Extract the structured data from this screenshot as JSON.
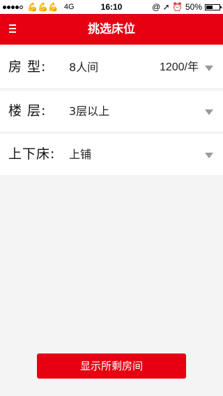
{
  "status_bar": {
    "signal_icons": "●●●○○",
    "emoji": "💪💪💪",
    "network": "4G",
    "time": "16:10",
    "right_icons": "@ ➚ ⏰",
    "battery": "50%",
    "battery_level": 0.5
  },
  "navbar": {
    "title": "挑选床位",
    "menu_icon": "hamburger-icon"
  },
  "rows": [
    {
      "label": "房  型:",
      "value": "8人间",
      "extra": "1200/年"
    },
    {
      "label": "楼  层:",
      "value": "3层以上",
      "extra": ""
    },
    {
      "label": "上下床:",
      "value": "上铺",
      "extra": ""
    }
  ],
  "action": {
    "label": "显示所剩房间"
  },
  "colors": {
    "accent": "#e60012",
    "background": "#f4f4f4"
  }
}
